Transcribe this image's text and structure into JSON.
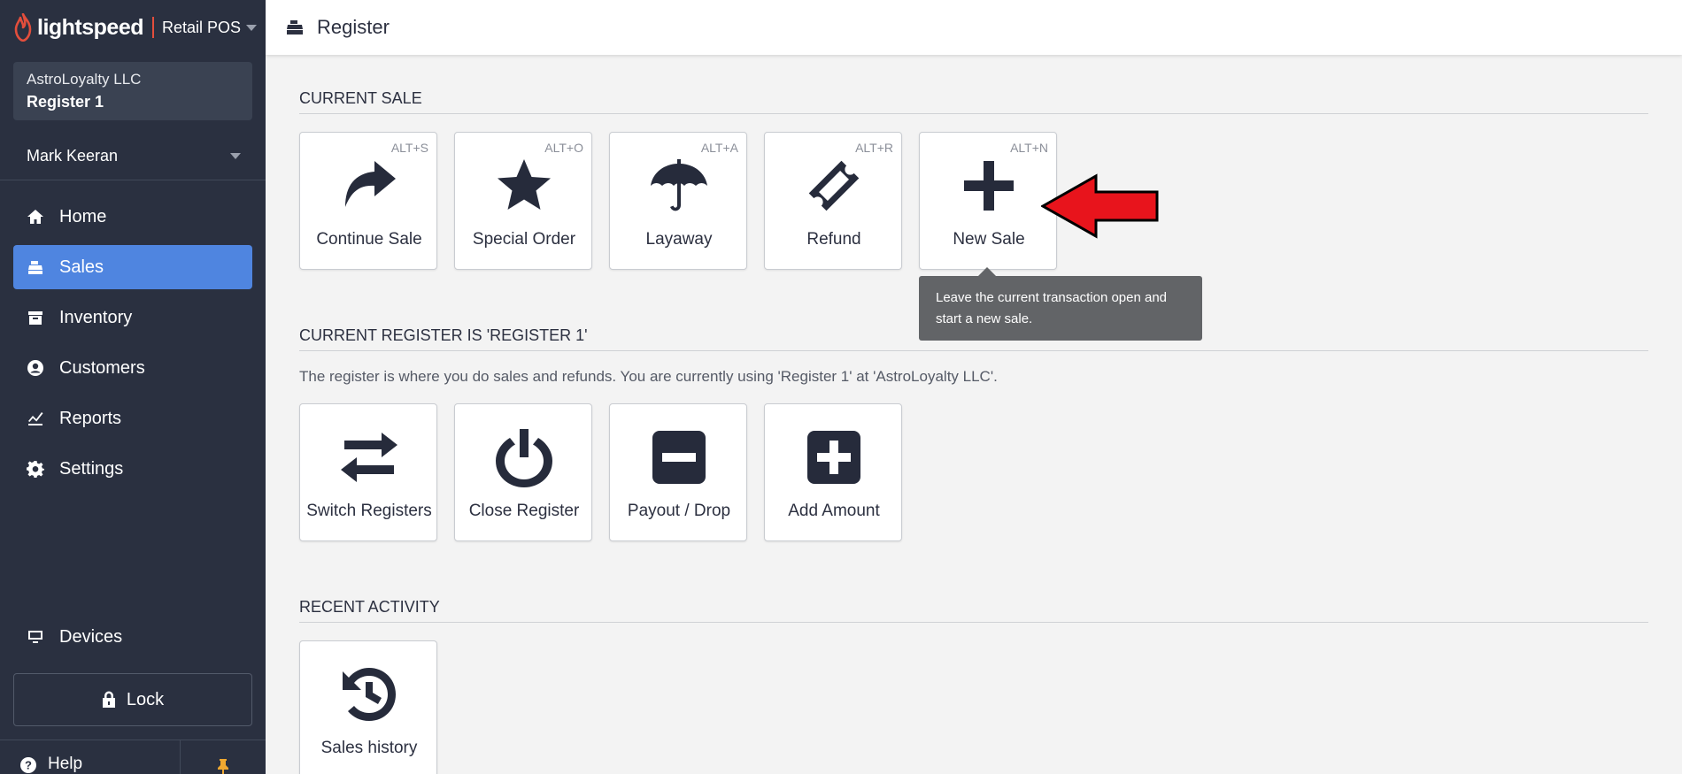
{
  "brand": {
    "name": "lightspeed",
    "product": "Retail POS"
  },
  "store": {
    "name": "AstroLoyalty LLC",
    "register": "Register 1"
  },
  "user": {
    "name": "Mark Keeran"
  },
  "nav": {
    "items": [
      {
        "label": "Home",
        "icon": "home-icon"
      },
      {
        "label": "Sales",
        "icon": "register-icon",
        "active": true
      },
      {
        "label": "Inventory",
        "icon": "inventory-icon"
      },
      {
        "label": "Customers",
        "icon": "customer-icon"
      },
      {
        "label": "Reports",
        "icon": "reports-icon"
      },
      {
        "label": "Settings",
        "icon": "gear-icon"
      }
    ],
    "devices": "Devices",
    "lock": "Lock",
    "help": "Help"
  },
  "header": {
    "title": "Register"
  },
  "current_sale": {
    "title": "CURRENT SALE",
    "tiles": [
      {
        "label": "Continue Sale",
        "shortcut": "ALT+S",
        "icon": "share-arrow-icon"
      },
      {
        "label": "Special Order",
        "shortcut": "ALT+O",
        "icon": "star-icon"
      },
      {
        "label": "Layaway",
        "shortcut": "ALT+A",
        "icon": "umbrella-icon"
      },
      {
        "label": "Refund",
        "shortcut": "ALT+R",
        "icon": "ticket-icon"
      },
      {
        "label": "New Sale",
        "shortcut": "ALT+N",
        "icon": "plus-icon"
      }
    ],
    "tooltip": "Leave the current transaction open and start a new sale."
  },
  "register": {
    "title": "CURRENT REGISTER IS 'REGISTER 1'",
    "description": "The register is where you do sales and refunds. You are currently using 'Register 1'  at 'AstroLoyalty LLC'.",
    "tiles": [
      {
        "label": "Switch Registers",
        "icon": "switch-arrows-icon"
      },
      {
        "label": "Close Register",
        "icon": "power-icon"
      },
      {
        "label": "Payout / Drop",
        "icon": "minus-square-icon"
      },
      {
        "label": "Add Amount",
        "icon": "plus-square-icon"
      }
    ]
  },
  "recent": {
    "title": "RECENT ACTIVITY",
    "tiles": [
      {
        "label": "Sales history",
        "icon": "history-icon"
      }
    ]
  },
  "colors": {
    "sidebar": "#2a3040",
    "active_nav": "#4f85e0",
    "brand_red": "#e34e3c",
    "tooltip": "#626467",
    "annotation_arrow": "#e8141c"
  }
}
